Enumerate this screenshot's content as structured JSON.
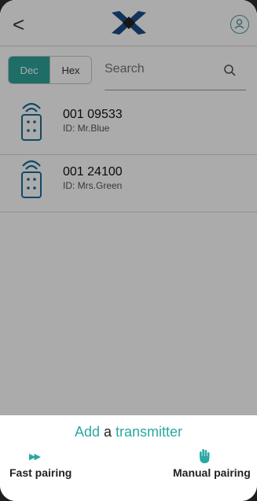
{
  "header": {
    "back_glyph": "<",
    "logo_icon": "logo-icon",
    "profile_icon": "profile-icon"
  },
  "filter": {
    "dec_label": "Dec",
    "hex_label": "Hex",
    "search_placeholder": "Search",
    "search_icon": "search-icon"
  },
  "transmitters": [
    {
      "code": "001 09533",
      "id_label": "ID: Mr.Blue"
    },
    {
      "code": "001 24100",
      "id_label": "ID: Mrs.Green"
    }
  ],
  "sheet": {
    "title_part1": "Add",
    "title_part2": "a",
    "title_part3": "transmitter",
    "fast_pairing_label": "Fast pairing",
    "manual_pairing_label": "Manual pairing",
    "fast_icon": "fast-forward-icon",
    "manual_icon": "hand-icon"
  },
  "colors": {
    "accent": "#2aa8a1",
    "logo_blue": "#1a4e8a",
    "overlay": "rgba(0,0,0,0.33)"
  }
}
